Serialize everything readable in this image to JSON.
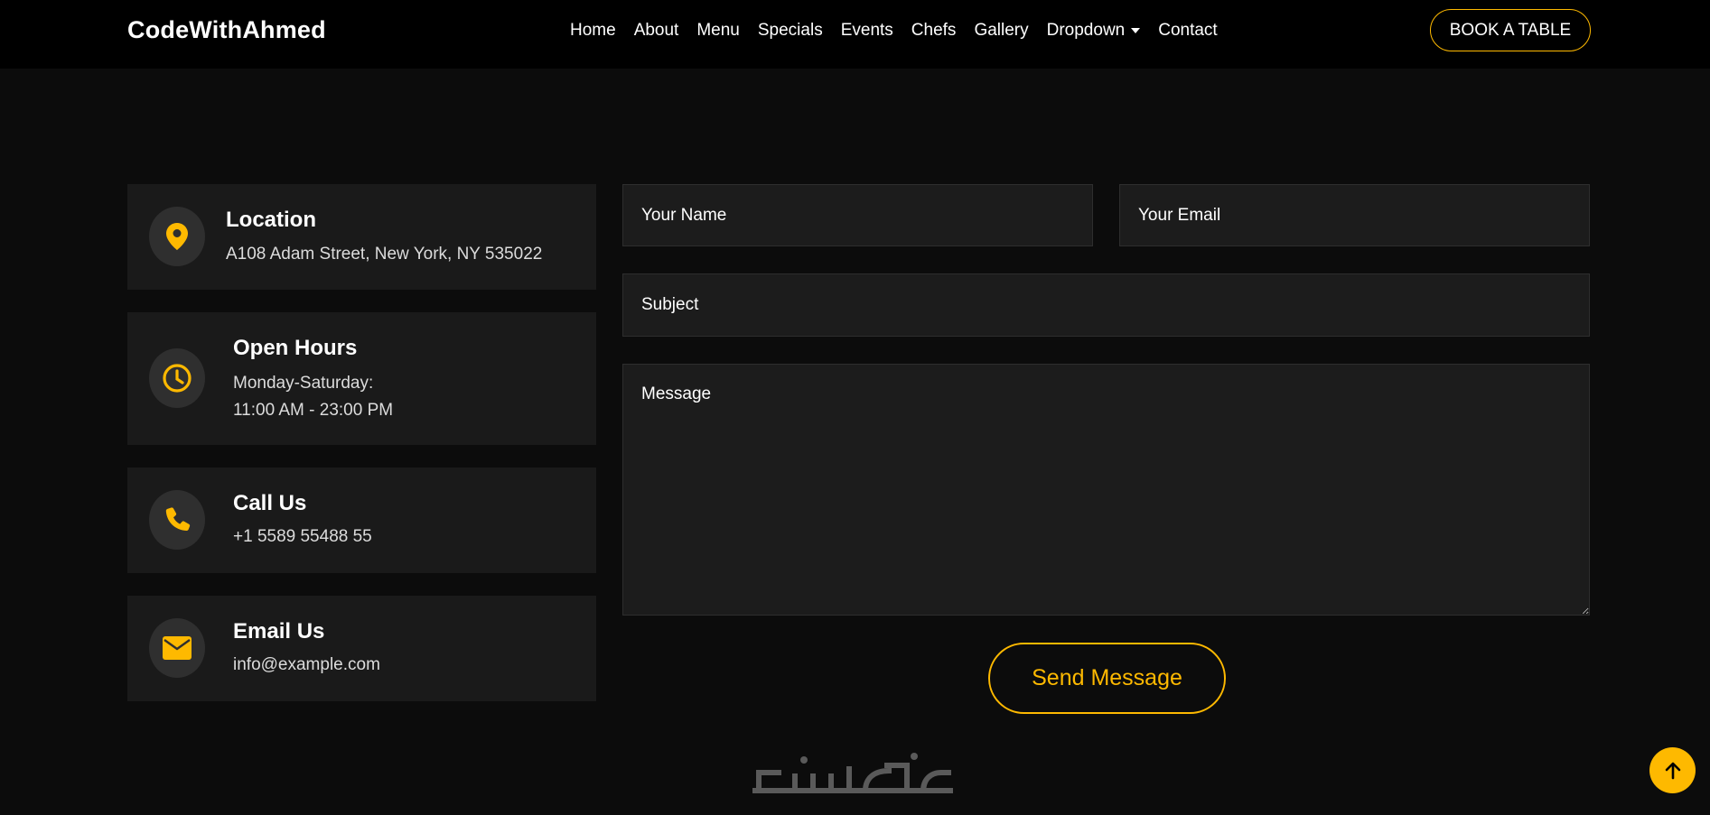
{
  "brand": {
    "name": "CodeWithAhmed"
  },
  "nav": {
    "items": [
      "Home",
      "About",
      "Menu",
      "Specials",
      "Events",
      "Chefs",
      "Gallery",
      "Dropdown",
      "Contact"
    ],
    "book_button": "BOOK A TABLE"
  },
  "info": {
    "location": {
      "title": "Location",
      "text": "A108 Adam Street, New York, NY 535022",
      "icon": "map-pin-icon"
    },
    "hours": {
      "title": "Open Hours",
      "line1": "Monday-Saturday:",
      "line2": "11:00 AM - 23:00 PM",
      "icon": "clock-icon"
    },
    "call": {
      "title": "Call Us",
      "text": "+1 5589 55488 55",
      "icon": "phone-icon"
    },
    "email": {
      "title": "Email Us",
      "text": "info@example.com",
      "icon": "envelope-icon"
    }
  },
  "form": {
    "name_placeholder": "Your Name",
    "email_placeholder": "Your Email",
    "subject_placeholder": "Subject",
    "message_placeholder": "Message",
    "send_button": "Send Message"
  },
  "watermark": {
    "text": "خمسات"
  },
  "colors": {
    "accent": "#feb900",
    "background": "#0c0c0c",
    "card": "#1a1a1a",
    "header": "#000000"
  }
}
